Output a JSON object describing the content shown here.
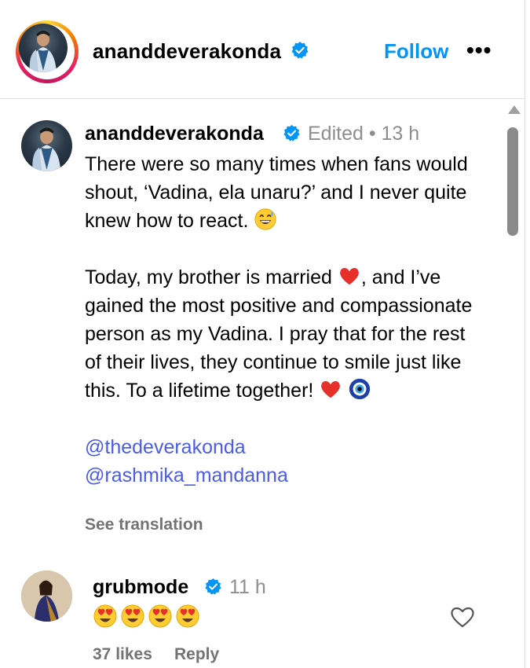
{
  "header": {
    "username": "ananddeverakonda",
    "follow_label": "Follow",
    "more_label": "•••",
    "verified_icon": "verified-badge-icon"
  },
  "caption": {
    "username": "ananddeverakonda",
    "meta": "Edited •  13 h",
    "paragraph1": "There were so many times when fans would shout, ‘Vadina, ela unaru?’ and I never quite knew how to react.",
    "paragraph2_a": "Today, my brother is married",
    "paragraph2_b": ", and I’ve gained the most positive and compassionate person as my Vadina. I pray that for the rest of their lives, they continue to smile just like this. To a lifetime together!",
    "mention1": "@thedeverakonda",
    "mention2": "@rashmika_mandanna",
    "see_translation": "See translation",
    "emojis": [
      "grinning-sweat-emoji",
      "red-heart-emoji",
      "red-heart-emoji",
      "nazar-amulet-emoji"
    ]
  },
  "comment": {
    "username": "grubmode",
    "time": "11 h",
    "emojis": [
      "heart-eyes-emoji",
      "heart-eyes-emoji",
      "heart-eyes-emoji",
      "heart-eyes-emoji"
    ],
    "likes": "37 likes",
    "reply_label": "Reply"
  },
  "colors": {
    "link_blue": "#0095f6",
    "mention_blue": "#4a5ce8",
    "muted_gray": "#737373",
    "verified_blue": "#0095f6"
  }
}
